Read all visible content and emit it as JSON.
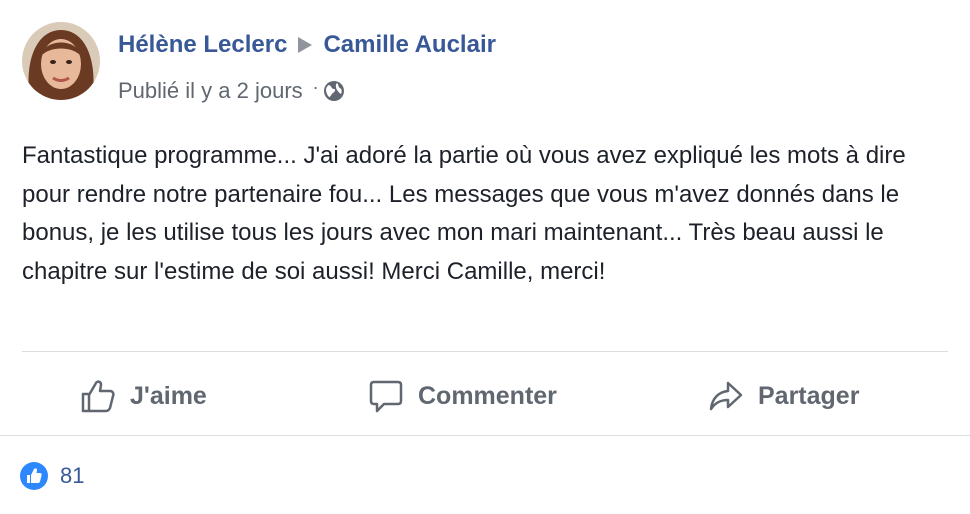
{
  "post": {
    "author": "Hélène Leclerc",
    "target": "Camille Auclair",
    "timestamp": "Publié il y a 2 jours",
    "separator": "·",
    "privacy_icon": "globe-icon",
    "text": "Fantastique programme... J'ai adoré la partie où vous avez expliqué les mots à dire pour rendre notre partenaire fou... Les messages que vous m'avez donnés dans le bonus, je les utilise tous les jours avec mon mari maintenant... Très beau aussi le chapitre sur l'estime de soi aussi! Merci Camille, merci!"
  },
  "actions": {
    "like": {
      "label": "J'aime",
      "icon": "thumbs-up-icon"
    },
    "comment": {
      "label": "Commenter",
      "icon": "comment-icon"
    },
    "share": {
      "label": "Partager",
      "icon": "share-icon"
    }
  },
  "reactions": {
    "icon": "like-reaction-icon",
    "count": "81"
  },
  "colors": {
    "link": "#385898",
    "secondary_text": "#606770",
    "divider": "#dadde1",
    "like_blue": "#2d88ff"
  }
}
